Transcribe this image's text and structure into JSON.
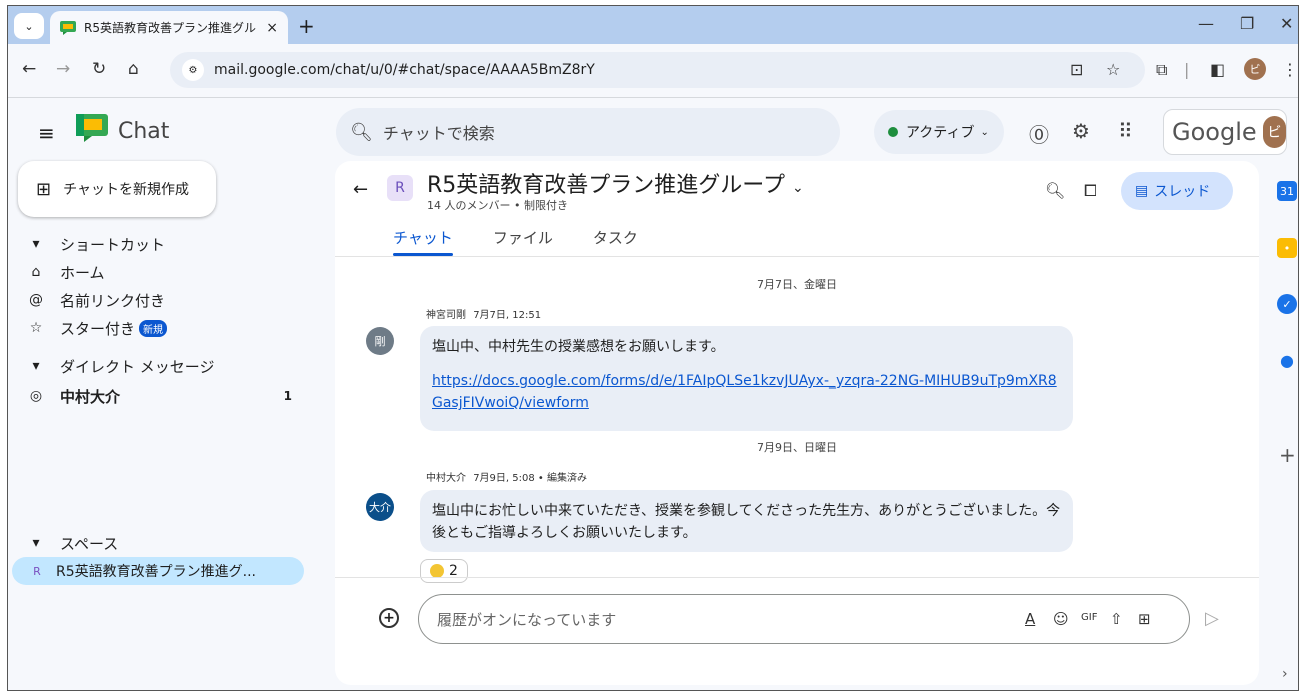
{
  "browser": {
    "tab_title": "R5英語教育改善プラン推進グル",
    "tab_close": "×",
    "new_tab": "+",
    "url": "mail.google.com/chat/u/0/#chat/space/AAAA5BmZ8rY",
    "profile_initial": "ビ"
  },
  "app": {
    "name": "Chat",
    "search_placeholder": "チャットで検索",
    "status": "アクティブ",
    "status_color": "#1e8e3e",
    "google_label": "Google",
    "avatar_initial": "ビ"
  },
  "sidebar": {
    "new_chat": "チャットを新規作成",
    "shortcuts_header": "ショートカット",
    "home": "ホーム",
    "mentions": "名前リンク付き",
    "starred": "スター付き",
    "starred_badge": "新規",
    "dm_header": "ダイレクト メッセージ",
    "dm_items": [
      {
        "name": "中村大介",
        "count": "1"
      }
    ],
    "spaces_header": "スペース",
    "space_items": [
      {
        "initial": "R",
        "name": "R5英語教育改善プラン推進グ..."
      }
    ]
  },
  "room": {
    "avatar": "R",
    "title": "R5英語教育改善プラン推進グループ",
    "subtitle": "14 人のメンバー • 制限付き",
    "thread_label": "スレッド",
    "tabs": [
      "チャット",
      "ファイル",
      "タスク"
    ]
  },
  "messages": [
    {
      "date": "7月7日、金曜日",
      "sender": "神宮司剛",
      "time": "7月7日, 12:51",
      "avatar": "剛",
      "avatar_color": "#6e7b87",
      "text": "塩山中、中村先生の授業感想をお願いします。",
      "link": "https://docs.google.com/forms/d/e/1FAIpQLSe1kzvJUAyx-_yzqra-22NG-MIHUB9uTp9mXR8GasjFIVwoiQ/viewform"
    },
    {
      "date": "7月9日、日曜日",
      "sender": "中村大介",
      "time": "7月9日, 5:08 • 編集済み",
      "avatar": "大介",
      "avatar_color": "#0b4f8a",
      "text": "塩山中にお忙しい中来ていただき、授業を参観してくださった先生方、ありがとうございました。今後ともご指導よろしくお願いいたします。",
      "reaction_count": "2"
    }
  ],
  "compose": {
    "placeholder": "履歴がオンになっています"
  }
}
